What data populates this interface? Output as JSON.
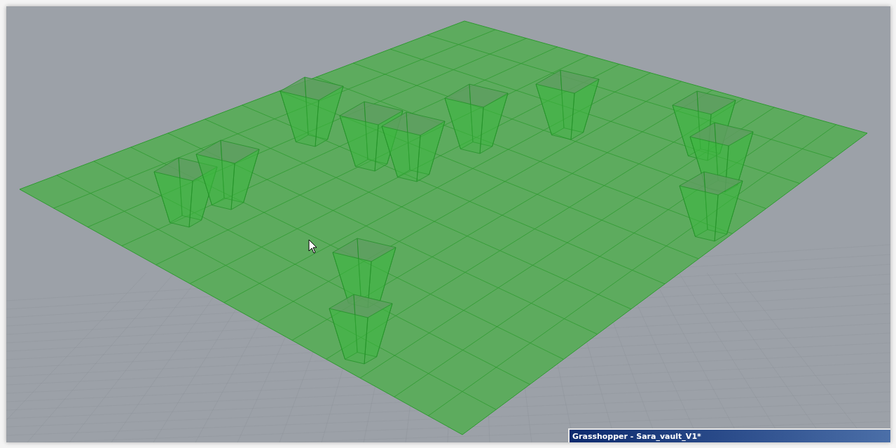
{
  "window_title": {
    "text": "Grasshopper - Sara_vault_V1*"
  }
}
